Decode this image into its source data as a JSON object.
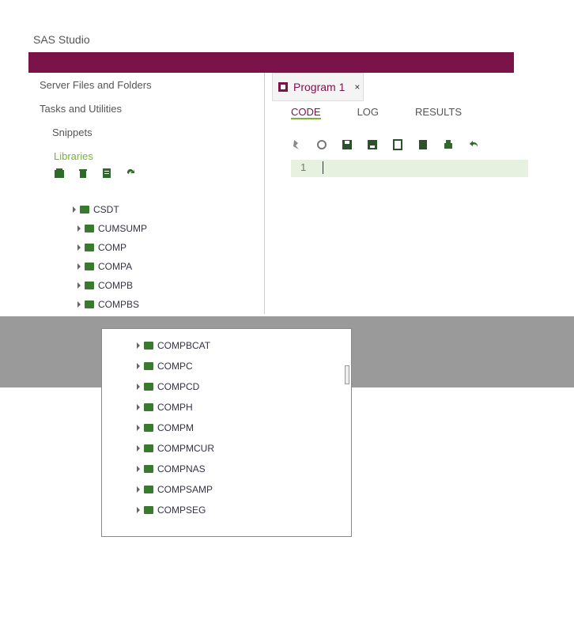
{
  "app": {
    "title": "SAS Studio",
    "accent_color": "#7a1347",
    "green_color": "#7ab23b"
  },
  "nav": {
    "items": [
      {
        "label": "Server Files and Folders"
      },
      {
        "label": "Tasks and Utilities"
      },
      {
        "label": "Snippets"
      },
      {
        "label": "Libraries"
      }
    ]
  },
  "library_toolbar": {
    "icons": [
      "new-library-icon",
      "delete-icon",
      "properties-icon",
      "refresh-icon"
    ]
  },
  "tree_main": [
    "CSDT",
    "CUMSUMP",
    "COMP",
    "COMPA",
    "COMPB",
    "COMPBS"
  ],
  "tree_dropdown": [
    "COMPBCAT",
    "COMPC",
    "COMPCD",
    "COMPH",
    "COMPM",
    "COMPMCUR",
    "COMPNAS",
    "COMPSAMP",
    "COMPSEG"
  ],
  "program_tab": {
    "label": "Program 1",
    "close": "×"
  },
  "subtabs": [
    {
      "label": "CODE"
    },
    {
      "label": "LOG"
    },
    {
      "label": "RESULTS"
    }
  ],
  "editor": {
    "line_number": "1"
  }
}
